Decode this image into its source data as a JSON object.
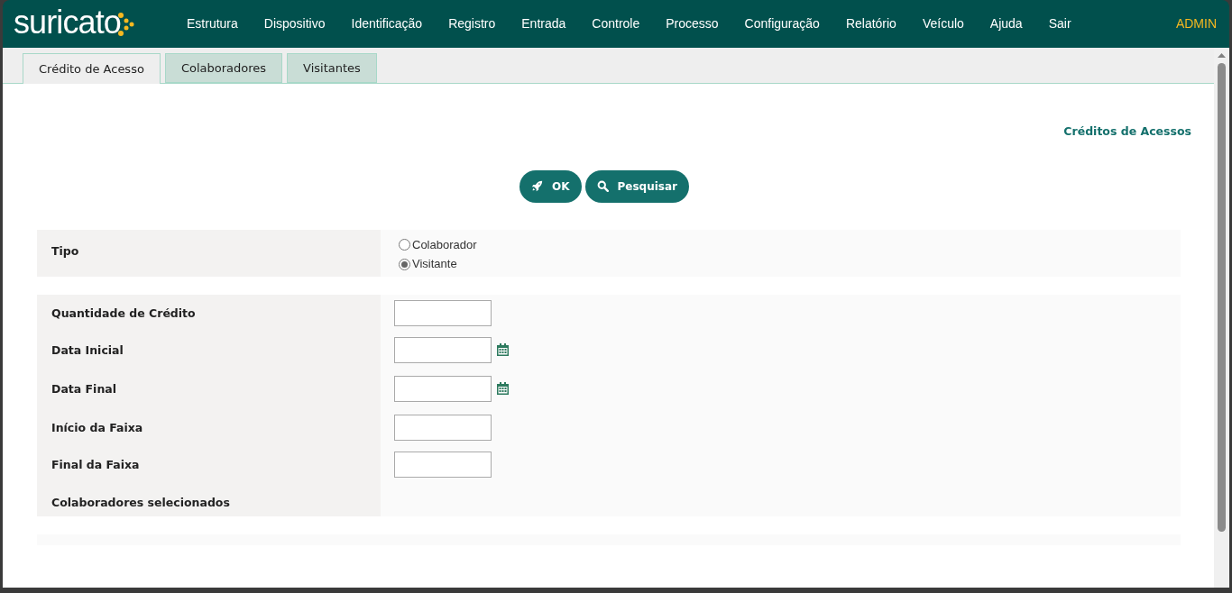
{
  "logo": {
    "text": "suricato"
  },
  "menu": [
    "Estrutura",
    "Dispositivo",
    "Identificação",
    "Registro",
    "Entrada",
    "Controle",
    "Processo",
    "Configuração",
    "Relatório",
    "Veículo",
    "Ajuda",
    "Sair"
  ],
  "user": "ADMIN",
  "tabs": [
    {
      "label": "Crédito de Acesso",
      "selected": true
    },
    {
      "label": "Colaboradores",
      "selected": false
    },
    {
      "label": "Visitantes",
      "selected": false
    }
  ],
  "page_title": "Créditos de Acessos",
  "buttons": [
    {
      "label": "OK",
      "kind": "ok"
    },
    {
      "label": "Pesquisar",
      "kind": "search"
    }
  ],
  "tipo": {
    "label": "Tipo",
    "options": [
      {
        "label": "Colaborador",
        "selected": false
      },
      {
        "label": "Visitante",
        "selected": true
      }
    ]
  },
  "fields": [
    {
      "label": "Quantidade de Crédito",
      "kind": "text"
    },
    {
      "label": "Data Inicial",
      "kind": "date"
    },
    {
      "label": "Data Final",
      "kind": "date"
    },
    {
      "label": "Início da Faixa",
      "kind": "text"
    },
    {
      "label": "Final da Faixa",
      "kind": "text"
    },
    {
      "label": "Colaboradores selecionados",
      "kind": "none"
    }
  ]
}
